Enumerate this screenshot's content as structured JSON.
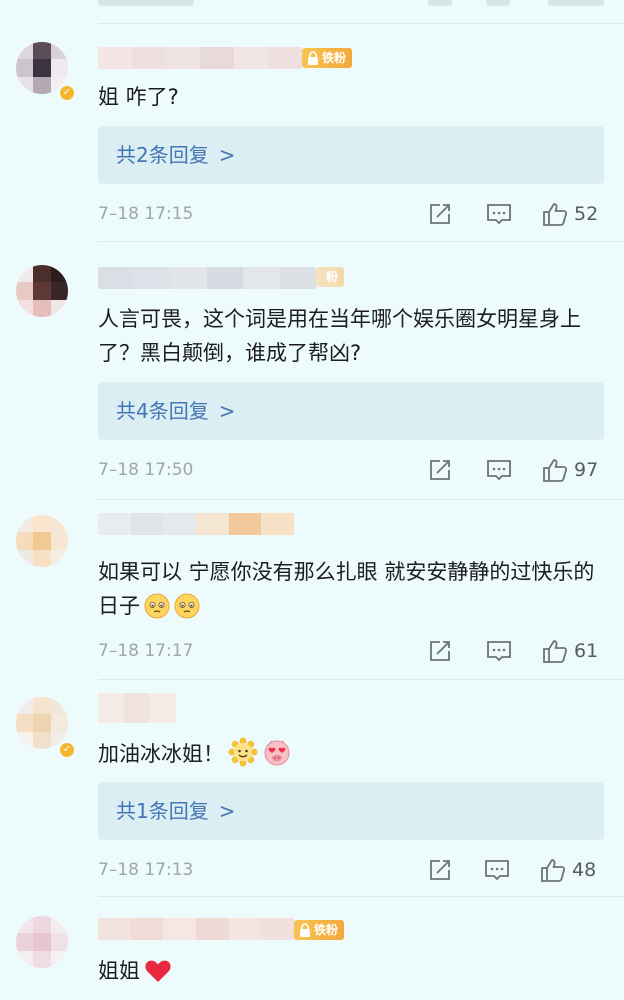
{
  "colors": {
    "background": "#eefbfd",
    "reply_box": "#dbeef3",
    "link_blue": "#4276b4",
    "badge_gold": "#f4a83b",
    "meta_gray": "#9ea6aa"
  },
  "comments": [
    {
      "badge": "铁粉",
      "text": "姐 咋了?",
      "reply_link": "共2条回复",
      "chevron": ">",
      "time": "7–18 17:15",
      "likes": "52",
      "icons": [
        "share-icon",
        "comment-icon",
        "like-icon"
      ]
    },
    {
      "badge": "粉",
      "text": "人言可畏，这个词是用在当年哪个娱乐圈女明星身上了？黑白颠倒，谁成了帮凶?",
      "reply_link": "共4条回复",
      "chevron": ">",
      "time": "7–18 17:50",
      "likes": "97",
      "icons": [
        "share-icon",
        "comment-icon",
        "like-icon"
      ]
    },
    {
      "badge": "",
      "text": "如果可以 宁愿你没有那么扎眼 就安安静静的过快乐的日子",
      "emojis": [
        "pleading-face-icon",
        "pleading-face-icon"
      ],
      "time": "7–18 17:17",
      "likes": "61",
      "icons": [
        "share-icon",
        "comment-icon",
        "like-icon"
      ]
    },
    {
      "badge": "",
      "text": "加油冰冰姐！",
      "emojis": [
        "sun-flower-face-icon",
        "heart-eyes-pig-icon"
      ],
      "reply_link": "共1条回复",
      "chevron": ">",
      "time": "7–18 17:13",
      "likes": "48",
      "icons": [
        "share-icon",
        "comment-icon",
        "like-icon"
      ]
    },
    {
      "badge": "铁粉",
      "text": "姐姐",
      "emojis": [
        "red-heart-icon"
      ]
    }
  ]
}
